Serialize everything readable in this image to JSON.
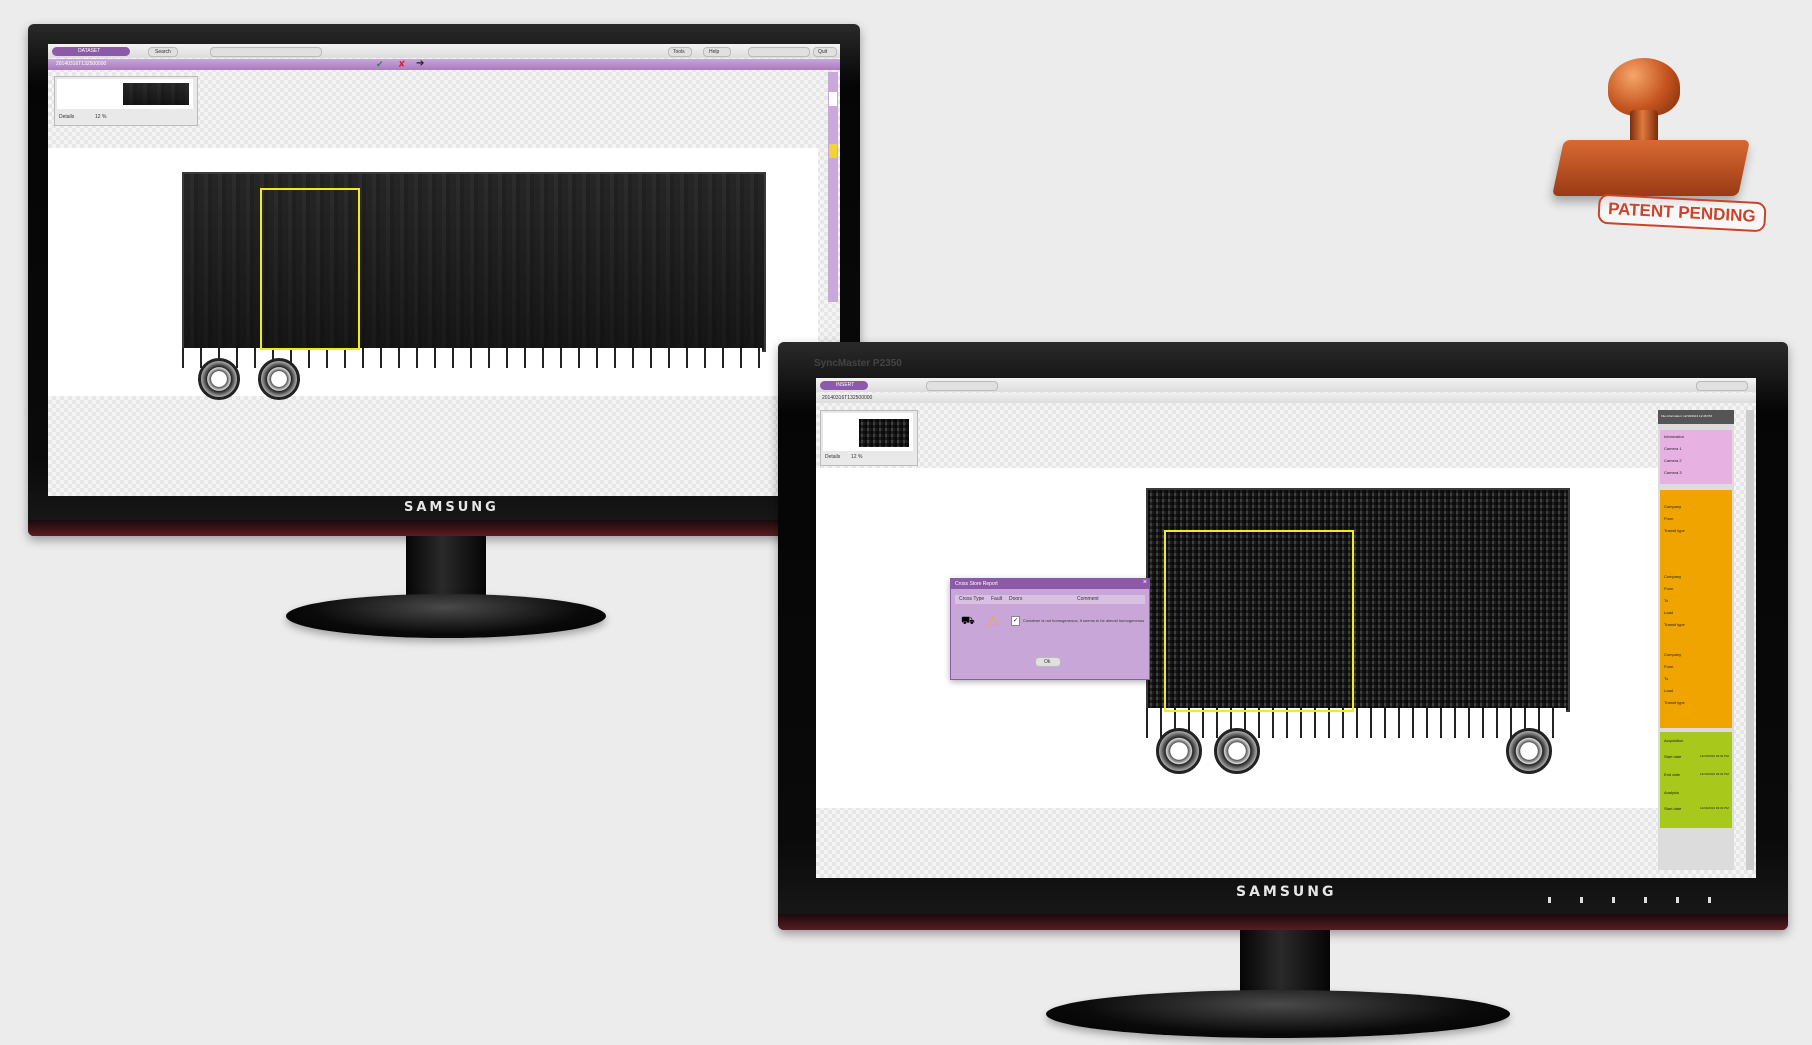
{
  "monitor1": {
    "brand": "SAMSUNG",
    "app": {
      "tab_label": "DATASET",
      "search_label": "Search",
      "tools_label": "Tools",
      "help_label": "Help",
      "quit_label": "Quit",
      "record_id": "20140316T132500000",
      "thumbnail_zoom": "12 %",
      "details_label": "Details"
    }
  },
  "monitor2": {
    "brand": "SAMSUNG",
    "model": "SyncMaster P2350",
    "app": {
      "tab_label": "INSERT",
      "record_id": "20140316T132500000",
      "thumbnail_zoom": "12 %",
      "details_label": "Details",
      "dialog": {
        "title": "Cross Store Report",
        "columns": [
          "Cross Type",
          "Fault",
          "Doors",
          "Comment"
        ],
        "comment": "Container is not homogeneous, It seems to be almost homogeneous",
        "ok_label": "Ok"
      },
      "sidebar": {
        "header": "File information: 12/16/2013 12:46 PM",
        "info_section": {
          "title": "Information",
          "items": [
            "Camera 1",
            "Camera 2",
            "Camera 3"
          ]
        },
        "cargo_section": {
          "items": [
            "Company",
            "From",
            "Transit type",
            "Company",
            "From",
            "To",
            "Load",
            "Transit type",
            "Company",
            "From",
            "To",
            "Load",
            "Transit type"
          ]
        },
        "acquisition_section": {
          "title": "Acquisition",
          "start_label": "Start date",
          "start_value": "12/16/2013 03:32 PM",
          "end_label": "End date",
          "end_value": "12/16/2013 03:32 PM",
          "analysis_title": "Analysis",
          "analysis_start_label": "Start date",
          "analysis_start_value": "12/16/2013 03:32 PM"
        }
      }
    }
  },
  "stamp": {
    "label": "PATENT PENDING"
  },
  "colors": {
    "purple": "#a77bbd",
    "orange": "#f0a400",
    "green": "#a9c81c",
    "highlight": "#f2ea1c",
    "stamp": "#c8442a"
  }
}
